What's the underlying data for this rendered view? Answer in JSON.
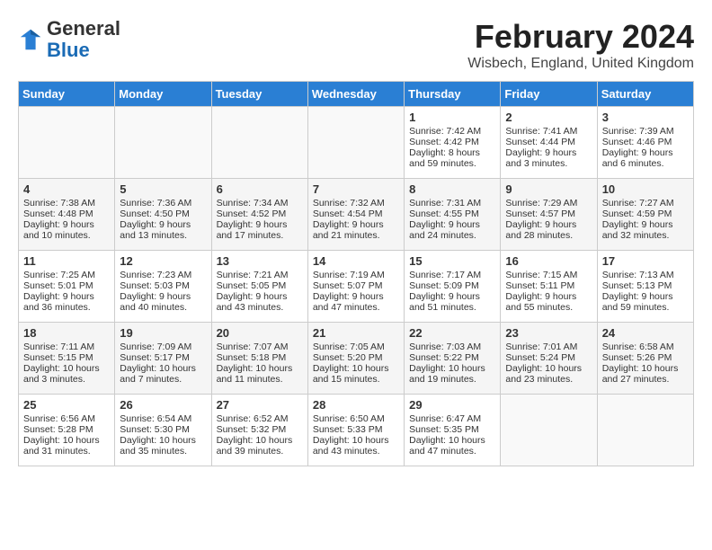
{
  "header": {
    "logo_general": "General",
    "logo_blue": "Blue",
    "month_title": "February 2024",
    "location": "Wisbech, England, United Kingdom"
  },
  "days_of_week": [
    "Sunday",
    "Monday",
    "Tuesday",
    "Wednesday",
    "Thursday",
    "Friday",
    "Saturday"
  ],
  "weeks": [
    [
      {
        "day": "",
        "info": ""
      },
      {
        "day": "",
        "info": ""
      },
      {
        "day": "",
        "info": ""
      },
      {
        "day": "",
        "info": ""
      },
      {
        "day": "1",
        "info": "Sunrise: 7:42 AM\nSunset: 4:42 PM\nDaylight: 8 hours and 59 minutes."
      },
      {
        "day": "2",
        "info": "Sunrise: 7:41 AM\nSunset: 4:44 PM\nDaylight: 9 hours and 3 minutes."
      },
      {
        "day": "3",
        "info": "Sunrise: 7:39 AM\nSunset: 4:46 PM\nDaylight: 9 hours and 6 minutes."
      }
    ],
    [
      {
        "day": "4",
        "info": "Sunrise: 7:38 AM\nSunset: 4:48 PM\nDaylight: 9 hours and 10 minutes."
      },
      {
        "day": "5",
        "info": "Sunrise: 7:36 AM\nSunset: 4:50 PM\nDaylight: 9 hours and 13 minutes."
      },
      {
        "day": "6",
        "info": "Sunrise: 7:34 AM\nSunset: 4:52 PM\nDaylight: 9 hours and 17 minutes."
      },
      {
        "day": "7",
        "info": "Sunrise: 7:32 AM\nSunset: 4:54 PM\nDaylight: 9 hours and 21 minutes."
      },
      {
        "day": "8",
        "info": "Sunrise: 7:31 AM\nSunset: 4:55 PM\nDaylight: 9 hours and 24 minutes."
      },
      {
        "day": "9",
        "info": "Sunrise: 7:29 AM\nSunset: 4:57 PM\nDaylight: 9 hours and 28 minutes."
      },
      {
        "day": "10",
        "info": "Sunrise: 7:27 AM\nSunset: 4:59 PM\nDaylight: 9 hours and 32 minutes."
      }
    ],
    [
      {
        "day": "11",
        "info": "Sunrise: 7:25 AM\nSunset: 5:01 PM\nDaylight: 9 hours and 36 minutes."
      },
      {
        "day": "12",
        "info": "Sunrise: 7:23 AM\nSunset: 5:03 PM\nDaylight: 9 hours and 40 minutes."
      },
      {
        "day": "13",
        "info": "Sunrise: 7:21 AM\nSunset: 5:05 PM\nDaylight: 9 hours and 43 minutes."
      },
      {
        "day": "14",
        "info": "Sunrise: 7:19 AM\nSunset: 5:07 PM\nDaylight: 9 hours and 47 minutes."
      },
      {
        "day": "15",
        "info": "Sunrise: 7:17 AM\nSunset: 5:09 PM\nDaylight: 9 hours and 51 minutes."
      },
      {
        "day": "16",
        "info": "Sunrise: 7:15 AM\nSunset: 5:11 PM\nDaylight: 9 hours and 55 minutes."
      },
      {
        "day": "17",
        "info": "Sunrise: 7:13 AM\nSunset: 5:13 PM\nDaylight: 9 hours and 59 minutes."
      }
    ],
    [
      {
        "day": "18",
        "info": "Sunrise: 7:11 AM\nSunset: 5:15 PM\nDaylight: 10 hours and 3 minutes."
      },
      {
        "day": "19",
        "info": "Sunrise: 7:09 AM\nSunset: 5:17 PM\nDaylight: 10 hours and 7 minutes."
      },
      {
        "day": "20",
        "info": "Sunrise: 7:07 AM\nSunset: 5:18 PM\nDaylight: 10 hours and 11 minutes."
      },
      {
        "day": "21",
        "info": "Sunrise: 7:05 AM\nSunset: 5:20 PM\nDaylight: 10 hours and 15 minutes."
      },
      {
        "day": "22",
        "info": "Sunrise: 7:03 AM\nSunset: 5:22 PM\nDaylight: 10 hours and 19 minutes."
      },
      {
        "day": "23",
        "info": "Sunrise: 7:01 AM\nSunset: 5:24 PM\nDaylight: 10 hours and 23 minutes."
      },
      {
        "day": "24",
        "info": "Sunrise: 6:58 AM\nSunset: 5:26 PM\nDaylight: 10 hours and 27 minutes."
      }
    ],
    [
      {
        "day": "25",
        "info": "Sunrise: 6:56 AM\nSunset: 5:28 PM\nDaylight: 10 hours and 31 minutes."
      },
      {
        "day": "26",
        "info": "Sunrise: 6:54 AM\nSunset: 5:30 PM\nDaylight: 10 hours and 35 minutes."
      },
      {
        "day": "27",
        "info": "Sunrise: 6:52 AM\nSunset: 5:32 PM\nDaylight: 10 hours and 39 minutes."
      },
      {
        "day": "28",
        "info": "Sunrise: 6:50 AM\nSunset: 5:33 PM\nDaylight: 10 hours and 43 minutes."
      },
      {
        "day": "29",
        "info": "Sunrise: 6:47 AM\nSunset: 5:35 PM\nDaylight: 10 hours and 47 minutes."
      },
      {
        "day": "",
        "info": ""
      },
      {
        "day": "",
        "info": ""
      }
    ]
  ]
}
